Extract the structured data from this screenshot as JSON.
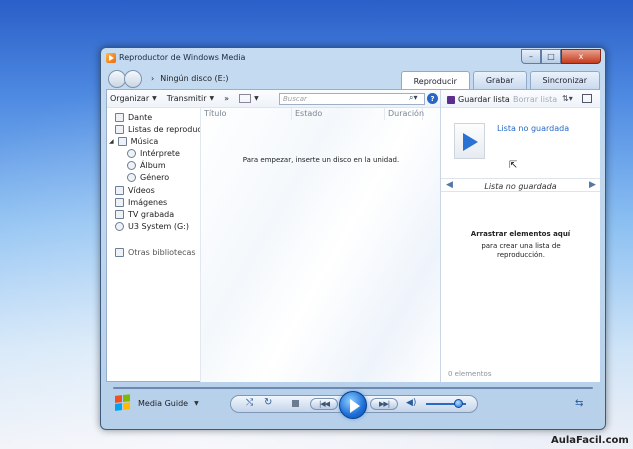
{
  "window": {
    "title": "Reproductor de Windows Media",
    "caption_buttons": {
      "minimize": "–",
      "maximize": "□",
      "close": "x"
    }
  },
  "navigation": {
    "separator": "›",
    "location": "Ningún disco (E:)"
  },
  "tabs": [
    {
      "label": "Reproducir",
      "active": true
    },
    {
      "label": "Grabar",
      "active": false
    },
    {
      "label": "Sincronizar",
      "active": false
    }
  ],
  "toolbar": {
    "organize": "Organizar",
    "stream": "Transmitir",
    "more": "»",
    "search_placeholder": "Buscar"
  },
  "sidebar": {
    "items": [
      {
        "label": "Dante",
        "level": 0
      },
      {
        "label": "Listas de reproducci",
        "level": 0
      },
      {
        "label": "Música",
        "level": 0
      },
      {
        "label": "Intérprete",
        "level": 1
      },
      {
        "label": "Álbum",
        "level": 1
      },
      {
        "label": "Género",
        "level": 1
      },
      {
        "label": "Vídeos",
        "level": 0
      },
      {
        "label": "Imágenes",
        "level": 0
      },
      {
        "label": "TV grabada",
        "level": 0
      },
      {
        "label": "U3 System (G:)",
        "level": 0
      },
      {
        "label": "Otras bibliotecas",
        "level": 0
      }
    ],
    "expand_symbol": "◢",
    "media_guide": "Media Guide"
  },
  "library": {
    "columns": [
      "Título",
      "Estado",
      "Duración"
    ],
    "empty_message": "Para empezar, inserte un disco en la unidad."
  },
  "playlist": {
    "save_list": "Guardar lista",
    "clear_list": "Borrar lista",
    "unsaved_link": "Lista no guardada",
    "list_title": "Lista no guardada",
    "drag_title": "Arrastrar elementos aquí",
    "drag_subtitle": "para crear una lista de reproducción.",
    "items_count": "0 elementos"
  },
  "player": {
    "shuffle": "⤭",
    "repeat": "↻",
    "prev": "|◀◀",
    "next": "▶▶|",
    "volume": "◀)",
    "volume_level": 0.82,
    "switch_view": "⇆"
  },
  "watermark": "AulaFacil.com",
  "colors": {
    "accent": "#2468c6",
    "play_button": "#1d6fd8",
    "desktop_top": "#2a5fc8"
  }
}
